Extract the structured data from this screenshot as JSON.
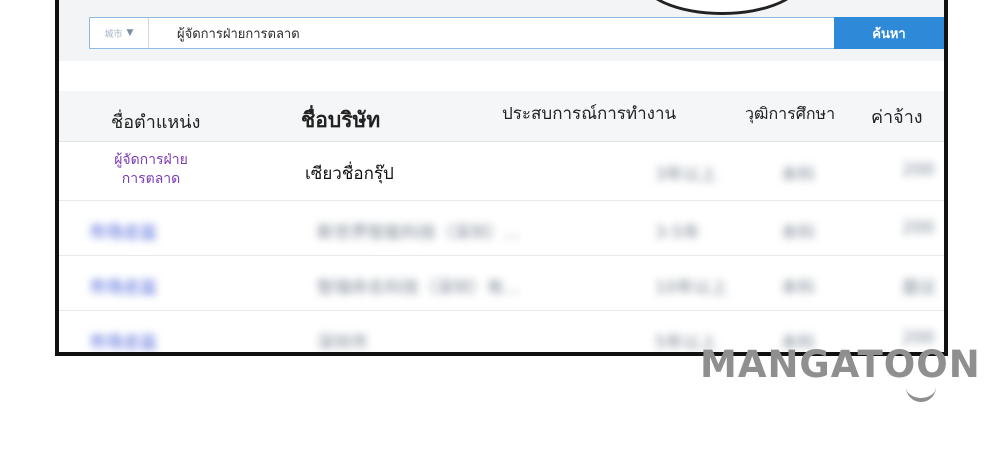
{
  "search": {
    "scope_label": "城市",
    "query": "ผู้จัดการฝ่ายการตลาด",
    "button_label": "ค้นหา"
  },
  "table": {
    "headers": [
      "ชื่อตำแหน่ง",
      "ชื่อบริษัท",
      "ประสบการณ์การทำงาน",
      "วุฒิการศึกษา",
      "ค่าจ้าง"
    ],
    "rows": [
      {
        "title_line1": "ผู้จัดการฝ่าย",
        "title_line2": "การตลาด",
        "company": "เซียวชื่อกรุ๊ป",
        "experience": "3年以上",
        "education": "本科",
        "salary": "200"
      },
      {
        "title": "市场总监",
        "company": "新世界智能科技（深圳）...",
        "experience": "3-5年",
        "education": "本科",
        "salary": "200"
      },
      {
        "title": "市场总监",
        "company": "智瑞命名科技（深圳）有...",
        "experience": "10年以上",
        "education": "本科",
        "salary": "面议"
      },
      {
        "title": "市场总监",
        "company": "深圳市",
        "experience": "5年以上",
        "education": "本科",
        "salary": "200"
      }
    ]
  },
  "watermark": {
    "text": "MANGATOON"
  }
}
